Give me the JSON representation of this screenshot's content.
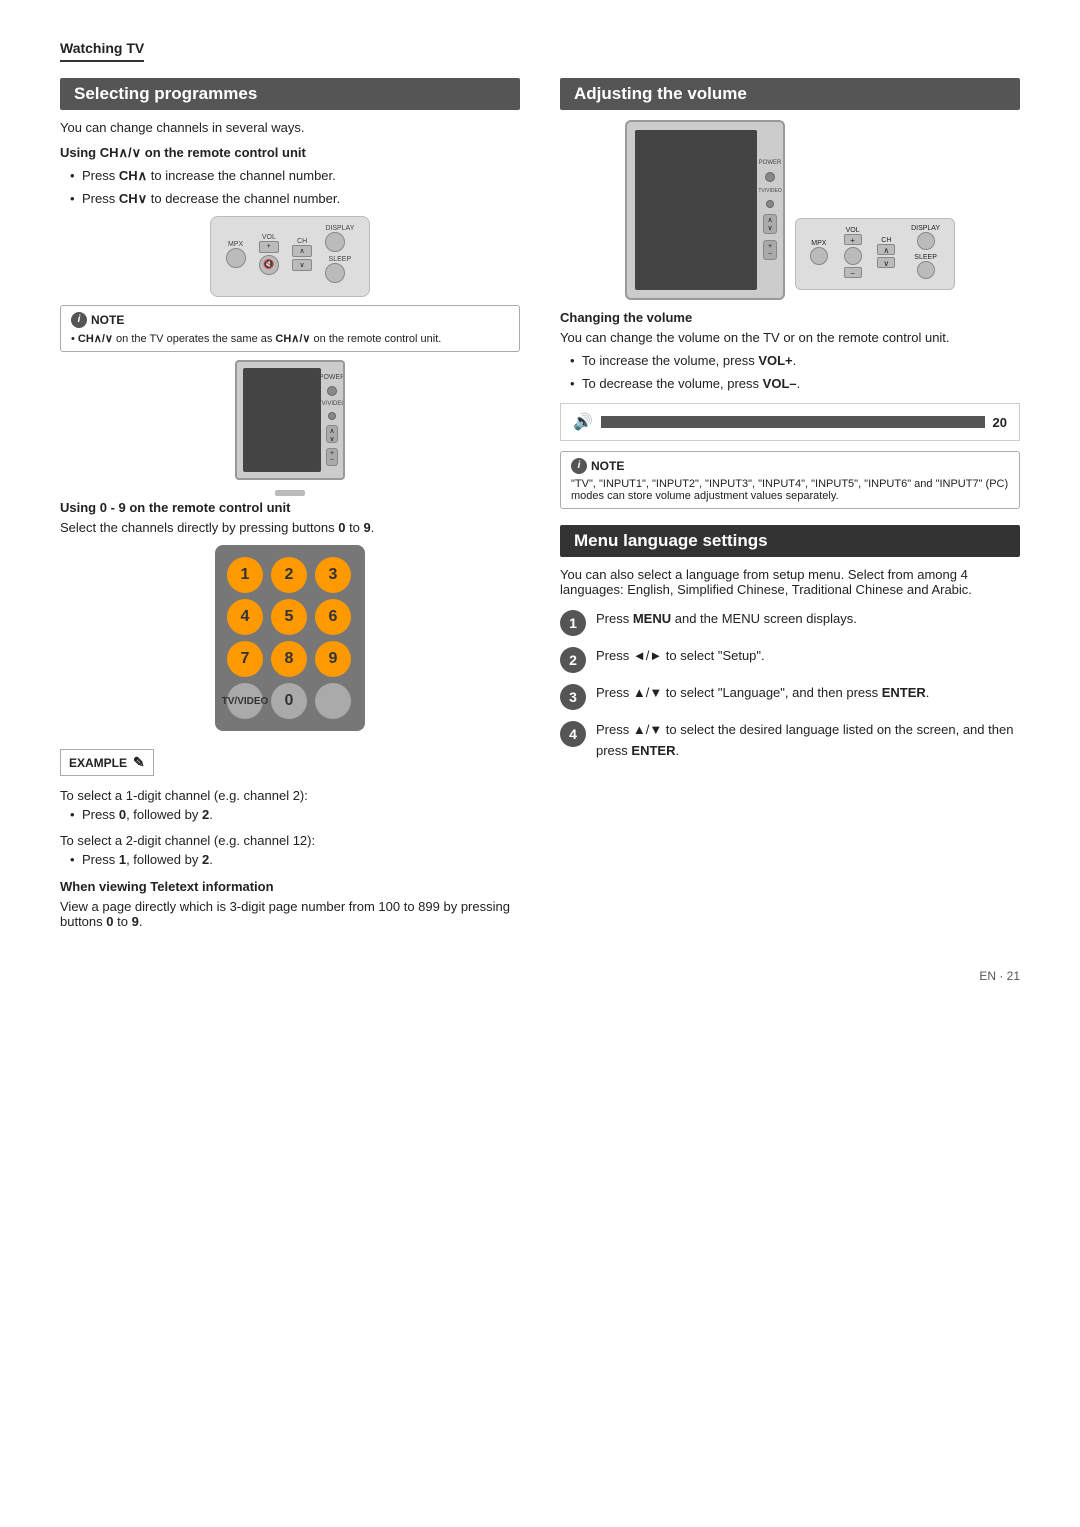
{
  "page": {
    "watching_tv": "Watching TV",
    "footer": "EN · 21"
  },
  "selecting": {
    "title": "Selecting programmes",
    "intro": "You can change channels in several ways.",
    "using_ch_title": "Using CH∧/∨ on the remote control unit",
    "ch_up": "Press CH∧ to increase the channel number.",
    "ch_down": "Press CH∨ to decrease the channel number.",
    "note_title": "NOTE",
    "note_text": "CH∧/∨ on the TV operates the same as CH∧/∨ on the remote control unit.",
    "using_0_9_title": "Using 0 - 9 on the remote control unit",
    "using_0_9_text": "Select the channels directly by pressing buttons 0 to 9.",
    "example_label": "EXAMPLE",
    "example_1_digit": "To select a 1-digit channel (e.g. channel 2):",
    "example_1_press": "Press 0, followed by 2.",
    "example_2_digit": "To select a 2-digit channel (e.g. channel 12):",
    "example_2_press": "Press 1, followed by 2.",
    "teletext_title": "When viewing Teletext information",
    "teletext_text": "View a page directly which is 3-digit page number from 100 to 899 by pressing buttons 0 to 9.",
    "keys": [
      "1",
      "2",
      "3",
      "4",
      "5",
      "6",
      "7",
      "8",
      "9",
      "⊛",
      "0",
      "○"
    ]
  },
  "adjusting": {
    "title": "Adjusting the volume",
    "changing_title": "Changing the volume",
    "changing_text": "You can change the volume on the TV or on the remote control unit.",
    "vol_increase": "To increase the volume, press VOL+.",
    "vol_decrease": "To decrease the volume, press VOL–.",
    "vol_value": "20",
    "note_title": "NOTE",
    "note_text": "\"TV\", \"INPUT1\", \"INPUT2\", \"INPUT3\", \"INPUT4\", \"INPUT5\", \"INPUT6\" and \"INPUT7\" (PC) modes can store volume adjustment values separately."
  },
  "menu_language": {
    "title": "Menu language settings",
    "intro": "You can also select a language from setup menu. Select from among 4 languages: English, Simplified Chinese, Traditional Chinese and Arabic.",
    "steps": [
      {
        "num": "1",
        "text": "Press MENU and the MENU screen displays."
      },
      {
        "num": "2",
        "text": "Press ◄/► to select \"Setup\"."
      },
      {
        "num": "3",
        "text": "Press ▲/▼ to select \"Language\", and then press ENTER."
      },
      {
        "num": "4",
        "text": "Press ▲/▼ to select the desired language listed on the screen, and then press ENTER."
      }
    ]
  },
  "remote_labels": {
    "mpx": "MPX",
    "vol": "VOL",
    "ch": "CH",
    "display": "DISPLAY",
    "sleep": "SLEEP",
    "plus": "+",
    "up_arrow": "∧",
    "down_arrow": "∨",
    "mute": "🔇"
  },
  "tv_labels": {
    "power": "POWER",
    "tv_video": "TV/VIDEO",
    "ch_up": "∧",
    "ch_down": "∨",
    "vol_plus": "+",
    "vol_minus": "−"
  }
}
